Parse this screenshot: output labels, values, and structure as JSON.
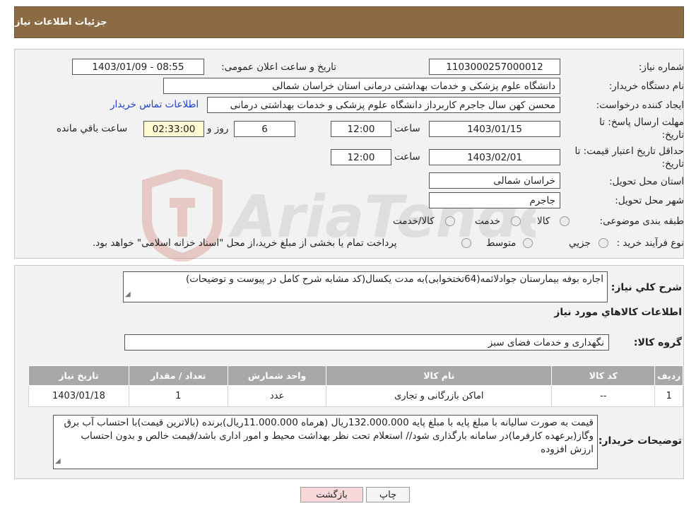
{
  "header": {
    "title": "جزئیات اطلاعات نیاز"
  },
  "fields": {
    "need_number_label": "شماره نیاز:",
    "need_number": "1103000257000012",
    "announce_label": "تاریخ و ساعت اعلان عمومی:",
    "announce_value": "1403/01/09 - 08:55",
    "buyer_org_label": "نام دستگاه خریدار:",
    "buyer_org": "دانشگاه علوم پزشکی و خدمات بهداشتی درمانی استان خراسان شمالی",
    "requester_label": "ایجاد کننده درخواست:",
    "requester": "محسن کهن سال جاجرم کاربرداز دانشگاه علوم پزشکی و خدمات بهداشتی درمانی",
    "contact_link": "اطلاعات تماس خریدار",
    "deadline_label_1": "مهلت ارسال پاسخ: تا",
    "deadline_label_2": "تاریخ:",
    "deadline_date": "1403/01/15",
    "time_label": "ساعت",
    "deadline_time": "12:00",
    "days_value": "6",
    "days_label": "روز و",
    "remaining_time": "02:33:00",
    "remaining_label": "ساعت باقي مانده",
    "validity_label_1": "حداقل تاريخ اعتبار قيمت: تا",
    "validity_label_2": "تاريخ:",
    "validity_date": "1403/02/01",
    "validity_time": "12:00",
    "province_label": "استان محل تحويل:",
    "province": "خراسان شمالی",
    "city_label": "شهر محل تحويل:",
    "city": "جاجرم",
    "category_label": "طبقه بندی موضوعی:",
    "category_options": [
      "کالا",
      "خدمت",
      "کالا/خدمت"
    ],
    "process_label": "نوع فرآيند خريد :",
    "process_options": [
      "جزيي",
      "متوسط"
    ],
    "process_note": "پرداخت تمام يا بخشی از مبلغ خريد،از محل \"اسناد خزانه اسلامی\" خواهد بود."
  },
  "description": {
    "label": "شرح کلي نياز:",
    "text": "اجاره بوفه بیمارستان جوادلائمه(64تختخوابی)به مدت یکسال(کد مشابه شرح کامل در پیوست و توضیحات)"
  },
  "goods": {
    "section_title": "اطلاعات کالاهاي مورد نياز",
    "group_label": "گروه کالا:",
    "group_value": "نگهداری و خدمات فضای سبز",
    "columns": [
      "رديف",
      "کد کالا",
      "نام کالا",
      "واحد شمارش",
      "تعداد / مقدار",
      "تاريخ نياز"
    ],
    "rows": [
      [
        "1",
        "--",
        "اماکن بازرگانی و تجاری",
        "عدد",
        "1",
        "1403/01/18"
      ]
    ]
  },
  "buyer_notes": {
    "label": "توضيحات خريدار:",
    "text": "قیمت به صورت سالیانه با مبلغ پایه با مبلغ پایه 132.000.000ریال (هرماه 11.000.000ریال)برنده (بالاترین قیمت)با احتساب آب برق وگاز(برعهده کارفرما)در سامانه بارگذاری شود// استعلام تحت نظر بهداشت محیط و امور اداری باشد/قیمت خالص و بدون احتساب ارزش افزوده"
  },
  "buttons": {
    "print": "چاپ",
    "back": "بازگشت"
  },
  "watermark": {
    "text": "AriaTender.neT"
  },
  "colors": {
    "header": "#8b6b43",
    "link": "#1f3fbf",
    "back_button": "#f7d9d9",
    "watermark": "#c0392b"
  }
}
